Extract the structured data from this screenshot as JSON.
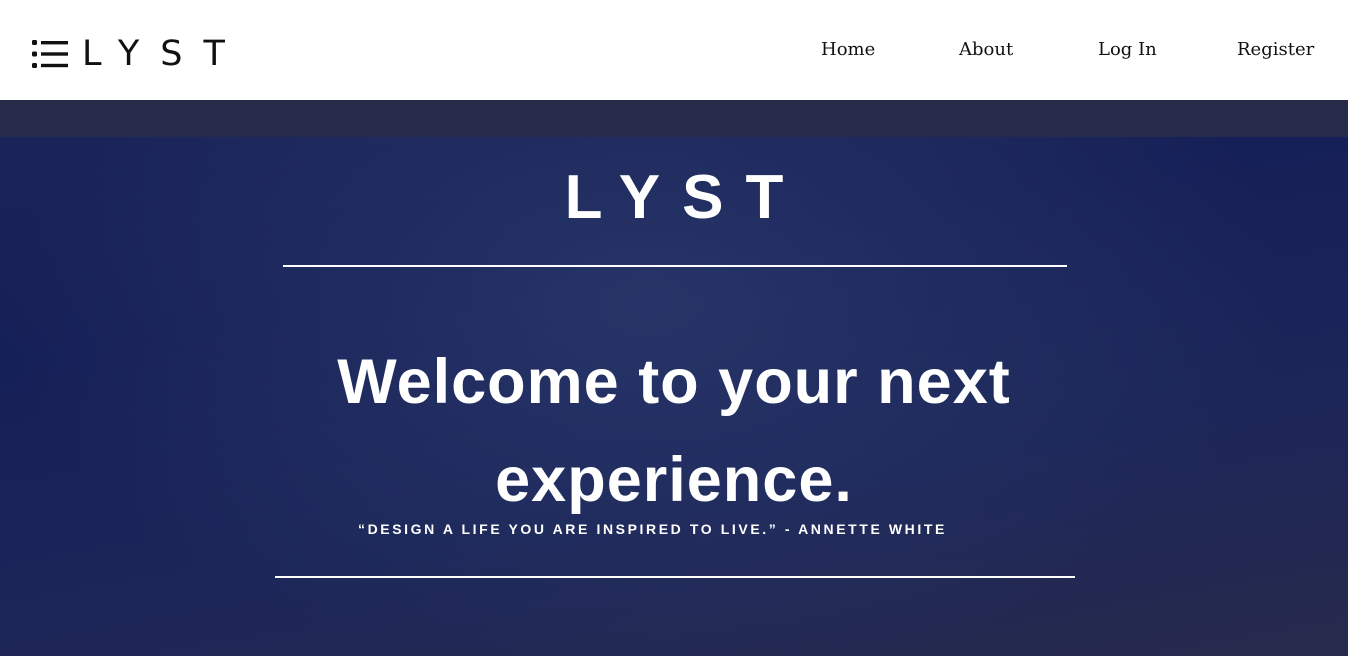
{
  "header": {
    "brand": {
      "icon": "list-icon",
      "text": "LYST"
    },
    "nav": [
      {
        "label": "Home"
      },
      {
        "label": "About"
      },
      {
        "label": "Log In"
      },
      {
        "label": "Register"
      }
    ]
  },
  "hero": {
    "logo": "LYST",
    "headline": "Welcome to your next experience.",
    "quote": "“DESIGN A LIFE YOU ARE INSPIRED TO LIVE.” - ANNETTE WHITE"
  },
  "colors": {
    "header_bg": "#ffffff",
    "strip": "#262b49",
    "hero_bg": "#1c2658",
    "hero_text": "#ffffff"
  }
}
